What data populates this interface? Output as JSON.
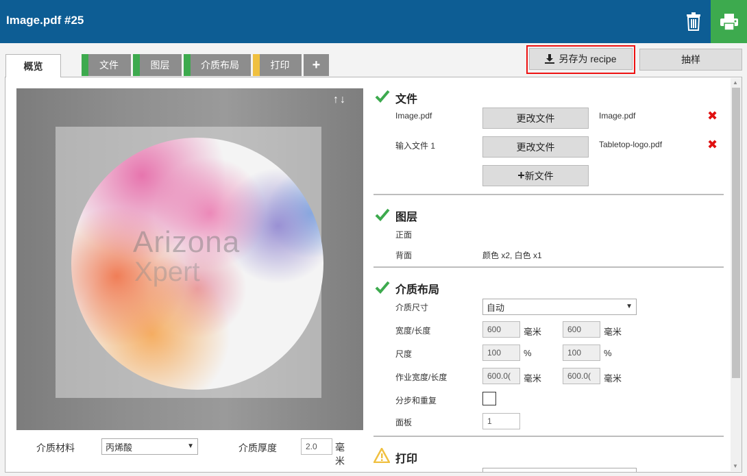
{
  "header": {
    "title": "Image.pdf #25",
    "icons": [
      "trash-icon",
      "printer-icon"
    ],
    "brand_color": "#0d5d94",
    "print_color": "#3daa4e"
  },
  "tabs": [
    {
      "label": "概览",
      "active": true
    },
    {
      "label": "文件",
      "status_color": "#3daa4e"
    },
    {
      "label": "图层",
      "status_color": "#3daa4e"
    },
    {
      "label": "介质布局",
      "status_color": "#3daa4e"
    },
    {
      "label": "打印",
      "status_color": "#f0c040"
    },
    {
      "label": "+"
    }
  ],
  "toolbar": {
    "save_recipe_label": "另存为 recipe",
    "sample_label": "抽样"
  },
  "preview": {
    "watermark_line1": "Arizona",
    "watermark_line2": "Xpert",
    "arrows": "↑↓"
  },
  "bottom": {
    "media_material_label": "介质材料",
    "media_material_value": "丙烯酸",
    "media_thickness_label": "介质厚度",
    "media_thickness_value": "2.0",
    "media_thickness_unit": "毫米"
  },
  "files": {
    "title": "文件",
    "rows": [
      {
        "label": "Image.pdf",
        "button": "更改文件",
        "file": "Image.pdf"
      },
      {
        "label": "输入文件 1",
        "button": "更改文件",
        "file": "Tabletop-logo.pdf"
      }
    ],
    "new_file_label": "新文件",
    "new_file_icon": "+"
  },
  "layers": {
    "title": "图层",
    "front_label": "正面",
    "back_label": "背面",
    "back_value": "颜色 x2, 白色 x1"
  },
  "media_layout": {
    "title": "介质布局",
    "size_label": "介质尺寸",
    "size_value": "自动",
    "width_length_label": "宽度/长度",
    "width_value": "600",
    "length_value": "600",
    "mm_unit": "毫米",
    "scale_label": "尺度",
    "scale_x": "100",
    "scale_y": "100",
    "percent_unit": "%",
    "job_size_label": "作业宽度/长度",
    "job_width": "600.0(",
    "job_length": "600.0(",
    "step_repeat_label": "分步和重复",
    "step_repeat_checked": false,
    "panel_label": "面板",
    "panel_value": "1"
  },
  "print": {
    "title": "打印",
    "status": "warning"
  }
}
